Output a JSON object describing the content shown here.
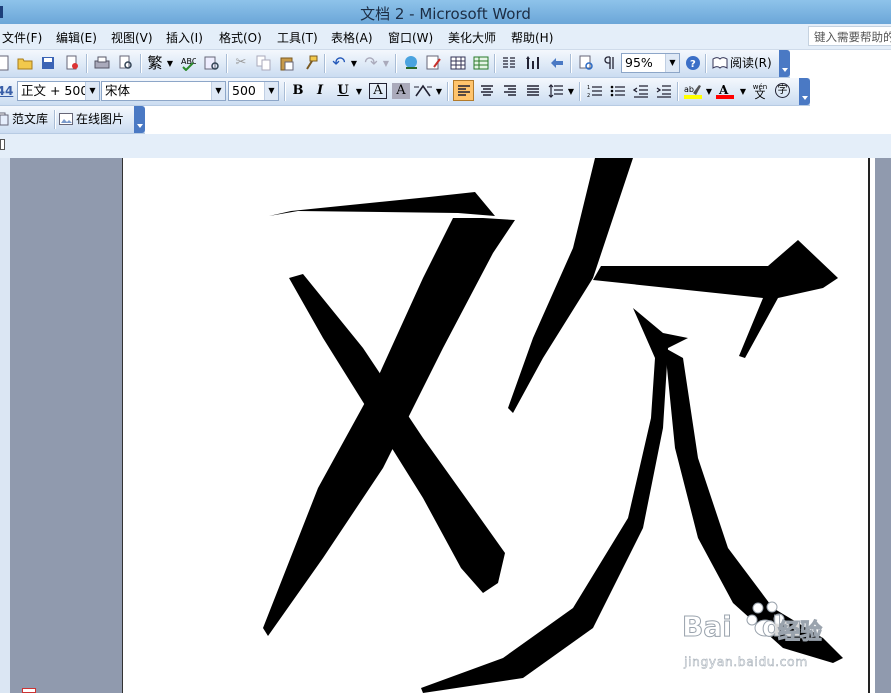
{
  "window": {
    "title": "文档 2 - Microsoft Word"
  },
  "menu": {
    "items": [
      "文件(F)",
      "编辑(E)",
      "视图(V)",
      "插入(I)",
      "格式(O)",
      "工具(T)",
      "表格(A)",
      "窗口(W)",
      "美化大师",
      "帮助(H)"
    ],
    "help_search_placeholder": "键入需要帮助的问题"
  },
  "standard_toolbar": {
    "zoom": "95%",
    "read_label": "阅读(R)",
    "icons": [
      "new-icon",
      "open-icon",
      "save-icon",
      "permission-icon",
      "print-icon",
      "print-preview-icon",
      "traditional-chinese-icon",
      "spelling-icon",
      "research-icon",
      "cut-icon",
      "copy-icon",
      "paste-icon",
      "format-painter-icon",
      "undo-icon",
      "redo-icon",
      "hyperlink-icon",
      "tables-borders-icon",
      "insert-table-icon",
      "insert-excel-icon",
      "columns-icon",
      "drawing-icon",
      "document-map-icon",
      "show-hide-icon",
      "help-icon"
    ]
  },
  "formatting_toolbar": {
    "style": "正文 + 500",
    "font": "宋体",
    "size": "500",
    "bold": "B",
    "italic": "I",
    "underline": "U",
    "char_border": "A",
    "char_shading": "A",
    "phonetic": "wén",
    "phonetic_char": "文",
    "enclosed_char": "字"
  },
  "extra_toolbar": {
    "template_library": "范文库",
    "online_pictures": "在线图片"
  },
  "document": {
    "text": "欢"
  },
  "watermark": {
    "brand": "Bai",
    "brand2": "du",
    "cn": "经验",
    "url": "jingyan.baidu.com"
  },
  "colors": {
    "title_bar": "#7ab3e2",
    "menu_bar": "#e4eef9",
    "doc_background": "#909aae",
    "highlight": "#ffff00",
    "font_color": "#ff0000",
    "pressed_button": "#ffc46c"
  }
}
